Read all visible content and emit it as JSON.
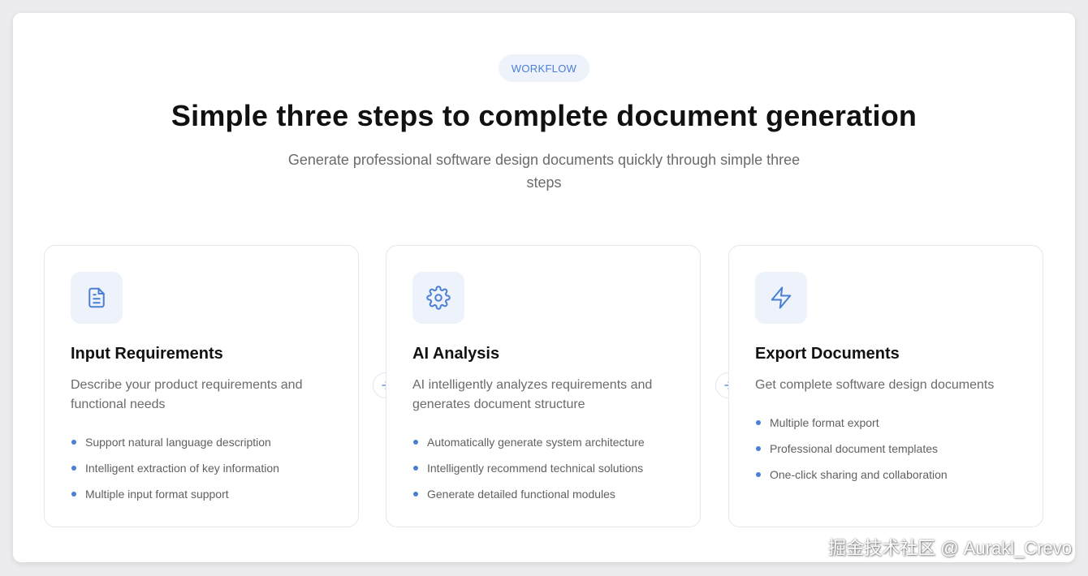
{
  "badge": "WORKFLOW",
  "title": "Simple three steps to complete document generation",
  "subtitle": "Generate professional software design documents quickly through simple three steps",
  "accent_color": "#4a7fd4",
  "steps": [
    {
      "icon": "document-icon",
      "title": "Input Requirements",
      "description": "Describe your product requirements and functional needs",
      "features": [
        "Support natural language description",
        "Intelligent extraction of key information",
        "Multiple input format support"
      ]
    },
    {
      "icon": "gear-icon",
      "title": "AI Analysis",
      "description": "AI intelligently analyzes requirements and generates document structure",
      "features": [
        "Automatically generate system architecture",
        "Intelligently recommend technical solutions",
        "Generate detailed functional modules"
      ]
    },
    {
      "icon": "lightning-icon",
      "title": "Export Documents",
      "description": "Get complete software design documents",
      "features": [
        "Multiple format export",
        "Professional document templates",
        "One-click sharing and collaboration"
      ]
    }
  ],
  "watermark": "掘金技术社区 @ Aurakl_Crevo"
}
